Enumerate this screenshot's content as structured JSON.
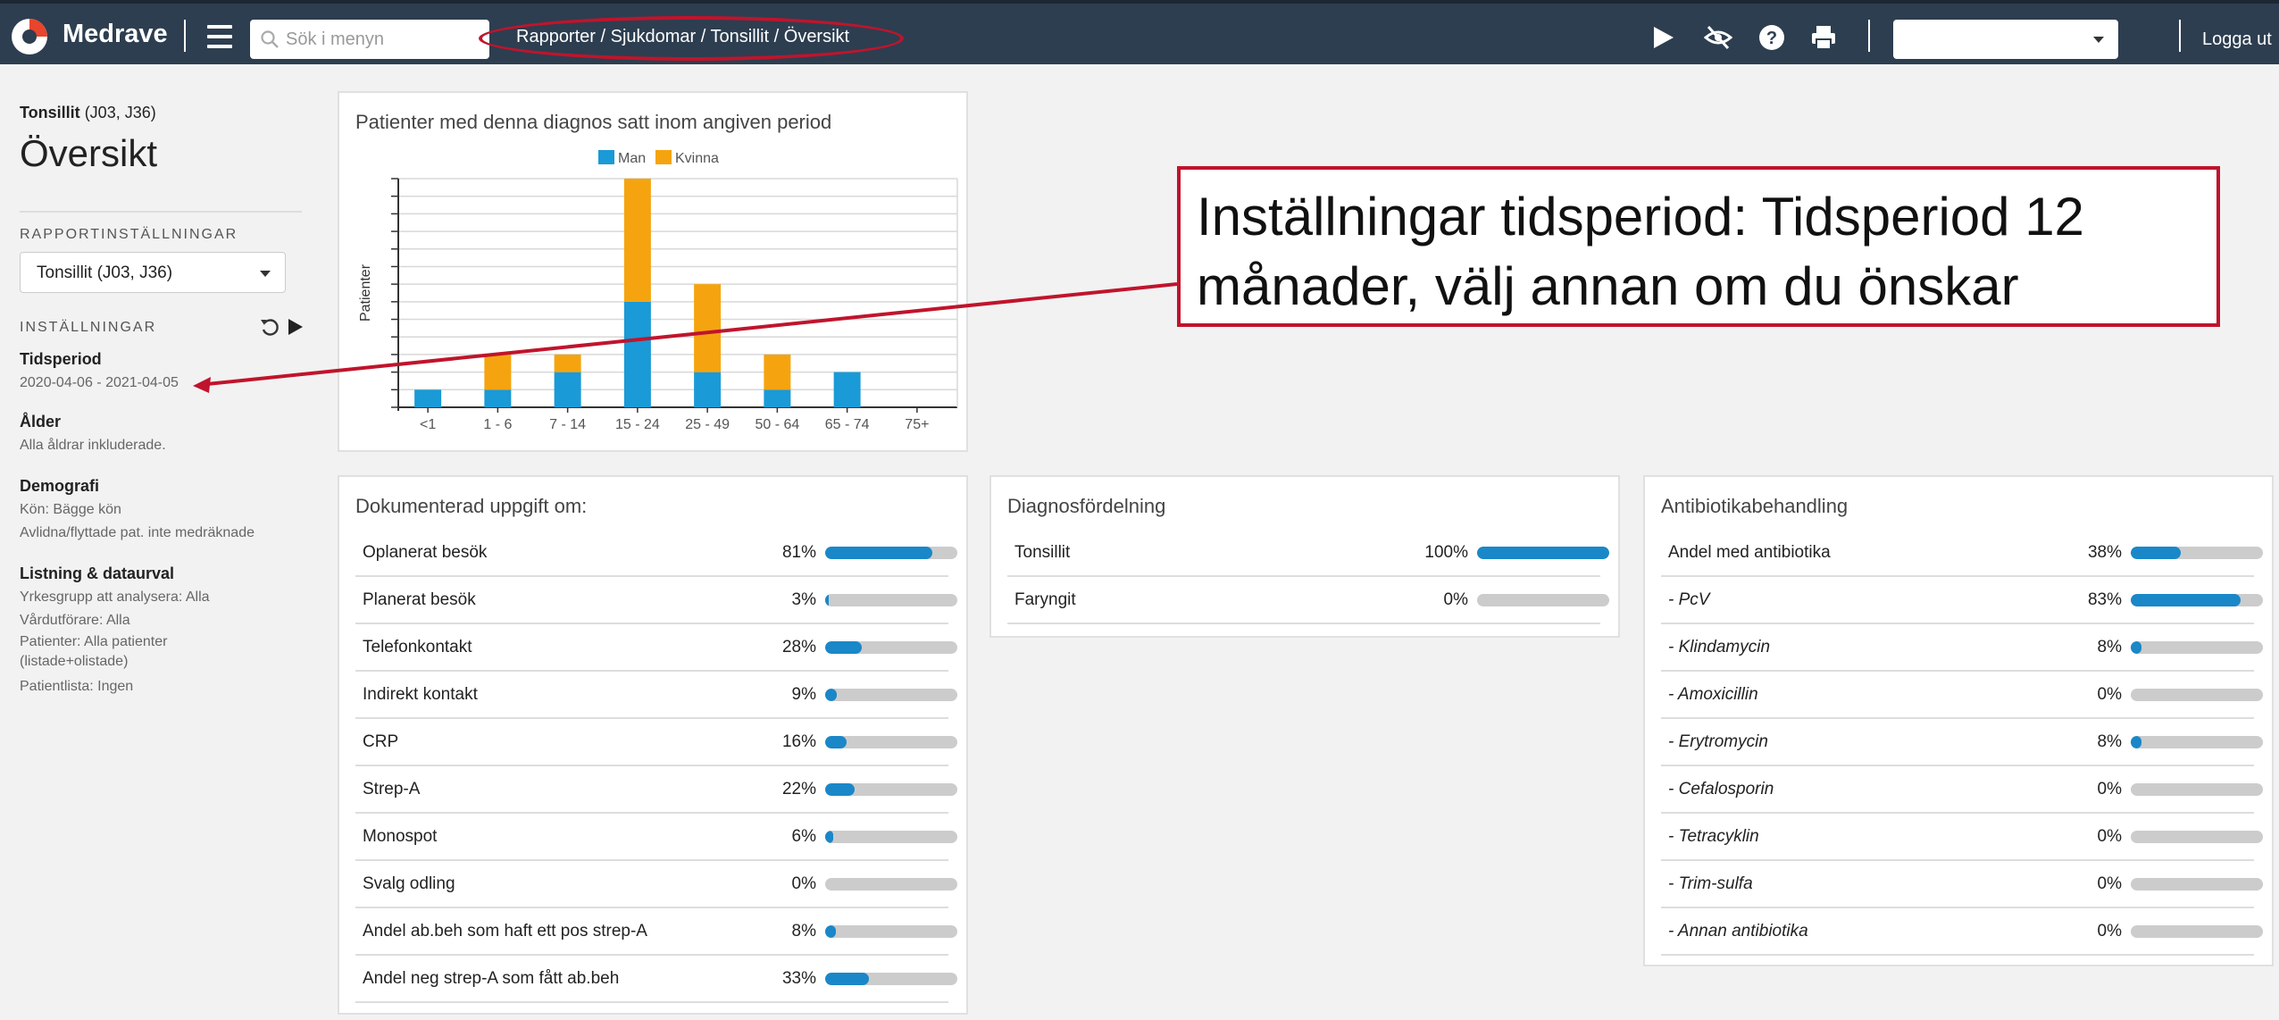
{
  "topbar": {
    "app_name": "Medrave",
    "search_placeholder": "Sök i menyn",
    "breadcrumb": "Rapporter / Sjukdomar / Tonsillit / Översikt",
    "logout": "Logga ut",
    "select_value": ""
  },
  "sidebar": {
    "diag_name": "Tonsillit",
    "diag_codes": "(J03, J36)",
    "title": "Översikt",
    "report_settings": "RAPPORTINSTÄLLNINGAR",
    "report_select": "Tonsillit (J03, J36)",
    "settings": "INSTÄLLNINGAR",
    "period_h": "Tidsperiod",
    "period_v": "2020-04-06 - 2021-04-05",
    "age_h": "Ålder",
    "age_v": "Alla åldrar inkluderade.",
    "demo_h": "Demografi",
    "demo_v1": "Kön: Bägge kön",
    "demo_v2": "Avlidna/flyttade pat. inte medräknade",
    "list_h": "Listning & dataurval",
    "list_v1": "Yrkesgrupp att analysera: Alla",
    "list_v2": "Vårdutförare: Alla",
    "list_v3": "Patienter: Alla patienter",
    "list_v4": "(listade+olistade)",
    "list_v5": "Patientlista: Ingen"
  },
  "chart_card": {
    "title": "Patienter med denna diagnos satt inom angiven period"
  },
  "chart_data": {
    "type": "bar",
    "stacked": true,
    "title": "Patienter med denna diagnos satt inom angiven period",
    "ylabel": "Patienter",
    "xlabel": "",
    "categories": [
      "<1",
      "1 - 6",
      "7 - 14",
      "15 - 24",
      "25 - 49",
      "50 - 64",
      "65 - 74",
      "75+"
    ],
    "series": [
      {
        "name": "Man",
        "color": "#1a9ad6",
        "values": [
          1,
          1,
          2,
          6,
          2,
          1,
          2,
          0
        ]
      },
      {
        "name": "Kvinna",
        "color": "#f5a40f",
        "values": [
          0,
          2,
          1,
          7,
          5,
          2,
          0,
          0
        ]
      }
    ],
    "ylim": [
      0,
      13
    ],
    "legend": "top-center",
    "grid": true
  },
  "doc_card": {
    "title": "Dokumenterad uppgift om:",
    "rows": [
      {
        "label": "Oplanerat besök",
        "pct": "81%",
        "value": 81
      },
      {
        "label": "Planerat besök",
        "pct": "3%",
        "value": 3
      },
      {
        "label": "Telefonkontakt",
        "pct": "28%",
        "value": 28
      },
      {
        "label": "Indirekt kontakt",
        "pct": "9%",
        "value": 9
      },
      {
        "label": "CRP",
        "pct": "16%",
        "value": 16
      },
      {
        "label": "Strep-A",
        "pct": "22%",
        "value": 22
      },
      {
        "label": "Monospot",
        "pct": "6%",
        "value": 6
      },
      {
        "label": "Svalg odling",
        "pct": "0%",
        "value": 0
      },
      {
        "label": "Andel ab.beh som haft ett pos strep-A",
        "pct": "8%",
        "value": 8
      },
      {
        "label": "Andel neg strep-A som fått ab.beh",
        "pct": "33%",
        "value": 33
      }
    ]
  },
  "diag_card": {
    "title": "Diagnosfördelning",
    "rows": [
      {
        "label": "Tonsillit",
        "pct": "100%",
        "value": 100
      },
      {
        "label": "Faryngit",
        "pct": "0%",
        "value": 0
      }
    ]
  },
  "ab_card": {
    "title": "Antibiotikabehandling",
    "rows": [
      {
        "label": "Andel med antibiotika",
        "pct": "38%",
        "value": 38,
        "italic": false
      },
      {
        "label": "- PcV",
        "pct": "83%",
        "value": 83,
        "italic": true
      },
      {
        "label": "- Klindamycin",
        "pct": "8%",
        "value": 8,
        "italic": true
      },
      {
        "label": "- Amoxicillin",
        "pct": "0%",
        "value": 0,
        "italic": true
      },
      {
        "label": "- Erytromycin",
        "pct": "8%",
        "value": 8,
        "italic": true
      },
      {
        "label": "- Cefalosporin",
        "pct": "0%",
        "value": 0,
        "italic": true
      },
      {
        "label": "- Tetracyklin",
        "pct": "0%",
        "value": 0,
        "italic": true
      },
      {
        "label": "- Trim-sulfa",
        "pct": "0%",
        "value": 0,
        "italic": true
      },
      {
        "label": "- Annan antibiotika",
        "pct": "0%",
        "value": 0,
        "italic": true
      }
    ]
  },
  "annotation": {
    "line1": "Inställningar tidsperiod: Tidsperiod 12",
    "line2": "månader, välj annan om du önskar"
  },
  "colors": {
    "topbar": "#2d3e50",
    "accent": "#1a87c8",
    "annotation": "#c0142c"
  }
}
